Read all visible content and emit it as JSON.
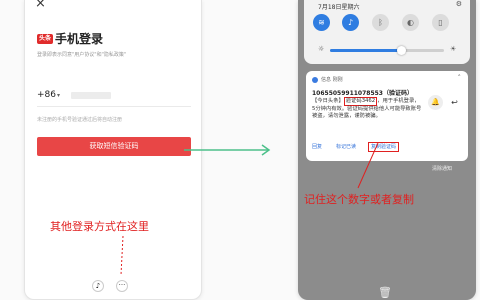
{
  "colors": {
    "brand_red": "#e84646",
    "annotation_red": "#e02020",
    "accent_blue": "#2f7de1",
    "arrow_green": "#4cc08a"
  },
  "left_phone": {
    "close_icon": "close-icon",
    "app_badge": "头条",
    "title": "手机登录",
    "agreement_text": "登录即表示同意\"用户协议\"和\"隐私政策\"",
    "country_code": "+86",
    "hint_text": "未注册的手机号验证通过后将自动注册",
    "get_code_label": "获取短信验证码",
    "annotation": "其他登录方式在这里",
    "tiktok_icon": "tiktok-icon",
    "more_label": "···"
  },
  "right_phone": {
    "date": "7月18日星期六",
    "brightness": 0.62,
    "quick_settings": [
      "wifi-icon",
      "bell-icon",
      "bluetooth-icon",
      "flashlight-icon",
      "vibrate-icon"
    ],
    "notification": {
      "app_name": "信息 刚刚",
      "sender": "10655059911078553（验证码）",
      "message_prefix": "【今日头条】",
      "code_label": "验证码3462",
      "message_suffix": "，用于手机登录，5分钟内有效。验证码提供给他人可能导致账号被盗，请勿泄露，谨防被骗。",
      "actions": {
        "reply": "回复",
        "mark_read": "标记已读",
        "copy_code": "复制验证码"
      }
    },
    "clear_label": "清除通知",
    "annotation": "记住这个数字或者复制"
  }
}
